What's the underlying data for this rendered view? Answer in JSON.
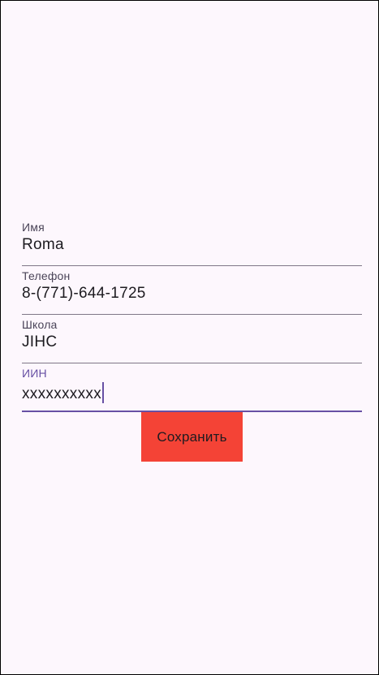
{
  "form": {
    "name": {
      "label": "Имя",
      "value": "Roma"
    },
    "phone": {
      "label": "Телефон",
      "value": "8-(771)-644-1725"
    },
    "school": {
      "label": "Школа",
      "value": "JIHC"
    },
    "iin": {
      "label": "ИИН",
      "value": "xxxxxxxxxx"
    }
  },
  "save_button": {
    "label": "Сохранить"
  },
  "colors": {
    "background": "#fdf7fd",
    "accent": "#6750a4",
    "button": "#f44336"
  }
}
